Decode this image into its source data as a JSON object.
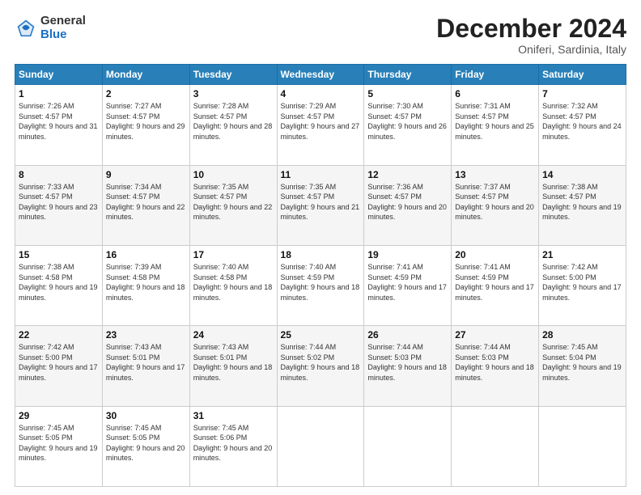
{
  "logo": {
    "general": "General",
    "blue": "Blue"
  },
  "header": {
    "month": "December 2024",
    "location": "Oniferi, Sardinia, Italy"
  },
  "weekdays": [
    "Sunday",
    "Monday",
    "Tuesday",
    "Wednesday",
    "Thursday",
    "Friday",
    "Saturday"
  ],
  "weeks": [
    [
      {
        "day": "1",
        "sunrise": "Sunrise: 7:26 AM",
        "sunset": "Sunset: 4:57 PM",
        "daylight": "Daylight: 9 hours and 31 minutes."
      },
      {
        "day": "2",
        "sunrise": "Sunrise: 7:27 AM",
        "sunset": "Sunset: 4:57 PM",
        "daylight": "Daylight: 9 hours and 29 minutes."
      },
      {
        "day": "3",
        "sunrise": "Sunrise: 7:28 AM",
        "sunset": "Sunset: 4:57 PM",
        "daylight": "Daylight: 9 hours and 28 minutes."
      },
      {
        "day": "4",
        "sunrise": "Sunrise: 7:29 AM",
        "sunset": "Sunset: 4:57 PM",
        "daylight": "Daylight: 9 hours and 27 minutes."
      },
      {
        "day": "5",
        "sunrise": "Sunrise: 7:30 AM",
        "sunset": "Sunset: 4:57 PM",
        "daylight": "Daylight: 9 hours and 26 minutes."
      },
      {
        "day": "6",
        "sunrise": "Sunrise: 7:31 AM",
        "sunset": "Sunset: 4:57 PM",
        "daylight": "Daylight: 9 hours and 25 minutes."
      },
      {
        "day": "7",
        "sunrise": "Sunrise: 7:32 AM",
        "sunset": "Sunset: 4:57 PM",
        "daylight": "Daylight: 9 hours and 24 minutes."
      }
    ],
    [
      {
        "day": "8",
        "sunrise": "Sunrise: 7:33 AM",
        "sunset": "Sunset: 4:57 PM",
        "daylight": "Daylight: 9 hours and 23 minutes."
      },
      {
        "day": "9",
        "sunrise": "Sunrise: 7:34 AM",
        "sunset": "Sunset: 4:57 PM",
        "daylight": "Daylight: 9 hours and 22 minutes."
      },
      {
        "day": "10",
        "sunrise": "Sunrise: 7:35 AM",
        "sunset": "Sunset: 4:57 PM",
        "daylight": "Daylight: 9 hours and 22 minutes."
      },
      {
        "day": "11",
        "sunrise": "Sunrise: 7:35 AM",
        "sunset": "Sunset: 4:57 PM",
        "daylight": "Daylight: 9 hours and 21 minutes."
      },
      {
        "day": "12",
        "sunrise": "Sunrise: 7:36 AM",
        "sunset": "Sunset: 4:57 PM",
        "daylight": "Daylight: 9 hours and 20 minutes."
      },
      {
        "day": "13",
        "sunrise": "Sunrise: 7:37 AM",
        "sunset": "Sunset: 4:57 PM",
        "daylight": "Daylight: 9 hours and 20 minutes."
      },
      {
        "day": "14",
        "sunrise": "Sunrise: 7:38 AM",
        "sunset": "Sunset: 4:57 PM",
        "daylight": "Daylight: 9 hours and 19 minutes."
      }
    ],
    [
      {
        "day": "15",
        "sunrise": "Sunrise: 7:38 AM",
        "sunset": "Sunset: 4:58 PM",
        "daylight": "Daylight: 9 hours and 19 minutes."
      },
      {
        "day": "16",
        "sunrise": "Sunrise: 7:39 AM",
        "sunset": "Sunset: 4:58 PM",
        "daylight": "Daylight: 9 hours and 18 minutes."
      },
      {
        "day": "17",
        "sunrise": "Sunrise: 7:40 AM",
        "sunset": "Sunset: 4:58 PM",
        "daylight": "Daylight: 9 hours and 18 minutes."
      },
      {
        "day": "18",
        "sunrise": "Sunrise: 7:40 AM",
        "sunset": "Sunset: 4:59 PM",
        "daylight": "Daylight: 9 hours and 18 minutes."
      },
      {
        "day": "19",
        "sunrise": "Sunrise: 7:41 AM",
        "sunset": "Sunset: 4:59 PM",
        "daylight": "Daylight: 9 hours and 17 minutes."
      },
      {
        "day": "20",
        "sunrise": "Sunrise: 7:41 AM",
        "sunset": "Sunset: 4:59 PM",
        "daylight": "Daylight: 9 hours and 17 minutes."
      },
      {
        "day": "21",
        "sunrise": "Sunrise: 7:42 AM",
        "sunset": "Sunset: 5:00 PM",
        "daylight": "Daylight: 9 hours and 17 minutes."
      }
    ],
    [
      {
        "day": "22",
        "sunrise": "Sunrise: 7:42 AM",
        "sunset": "Sunset: 5:00 PM",
        "daylight": "Daylight: 9 hours and 17 minutes."
      },
      {
        "day": "23",
        "sunrise": "Sunrise: 7:43 AM",
        "sunset": "Sunset: 5:01 PM",
        "daylight": "Daylight: 9 hours and 17 minutes."
      },
      {
        "day": "24",
        "sunrise": "Sunrise: 7:43 AM",
        "sunset": "Sunset: 5:01 PM",
        "daylight": "Daylight: 9 hours and 18 minutes."
      },
      {
        "day": "25",
        "sunrise": "Sunrise: 7:44 AM",
        "sunset": "Sunset: 5:02 PM",
        "daylight": "Daylight: 9 hours and 18 minutes."
      },
      {
        "day": "26",
        "sunrise": "Sunrise: 7:44 AM",
        "sunset": "Sunset: 5:03 PM",
        "daylight": "Daylight: 9 hours and 18 minutes."
      },
      {
        "day": "27",
        "sunrise": "Sunrise: 7:44 AM",
        "sunset": "Sunset: 5:03 PM",
        "daylight": "Daylight: 9 hours and 18 minutes."
      },
      {
        "day": "28",
        "sunrise": "Sunrise: 7:45 AM",
        "sunset": "Sunset: 5:04 PM",
        "daylight": "Daylight: 9 hours and 19 minutes."
      }
    ],
    [
      {
        "day": "29",
        "sunrise": "Sunrise: 7:45 AM",
        "sunset": "Sunset: 5:05 PM",
        "daylight": "Daylight: 9 hours and 19 minutes."
      },
      {
        "day": "30",
        "sunrise": "Sunrise: 7:45 AM",
        "sunset": "Sunset: 5:05 PM",
        "daylight": "Daylight: 9 hours and 20 minutes."
      },
      {
        "day": "31",
        "sunrise": "Sunrise: 7:45 AM",
        "sunset": "Sunset: 5:06 PM",
        "daylight": "Daylight: 9 hours and 20 minutes."
      },
      null,
      null,
      null,
      null
    ]
  ]
}
